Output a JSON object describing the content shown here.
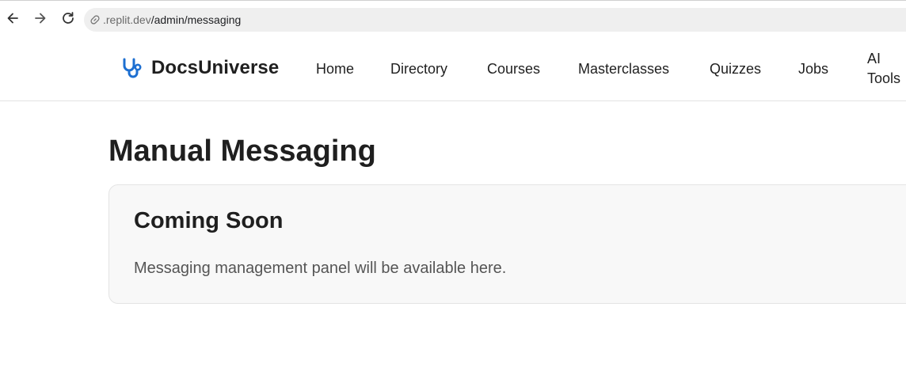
{
  "browser": {
    "url_host": ".replit.dev",
    "url_path": "/admin/messaging"
  },
  "header": {
    "brand_name": "DocsUniverse",
    "logo_icon": "stethoscope-icon",
    "accent_color": "#1d6fd1",
    "nav": [
      {
        "label": "Home"
      },
      {
        "label": "Directory"
      },
      {
        "label": "Courses"
      },
      {
        "label": "Masterclasses"
      },
      {
        "label": "Quizzes"
      },
      {
        "label": "Jobs"
      },
      {
        "label": "AI Tools"
      }
    ]
  },
  "main": {
    "page_title": "Manual Messaging",
    "card": {
      "title": "Coming Soon",
      "description": "Messaging management panel will be available here."
    }
  }
}
